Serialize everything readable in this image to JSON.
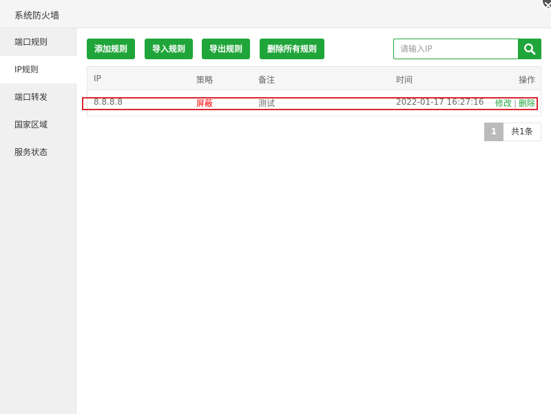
{
  "window": {
    "title": "系统防火墙"
  },
  "sidebar": {
    "items": [
      {
        "label": "端口规则"
      },
      {
        "label": "IP规则"
      },
      {
        "label": "端口转发"
      },
      {
        "label": "国家区域"
      },
      {
        "label": "服务状态"
      }
    ],
    "active_index": 1
  },
  "toolbar": {
    "add_label": "添加规则",
    "import_label": "导入规则",
    "export_label": "导出规则",
    "delete_all_label": "删除所有规则"
  },
  "search": {
    "placeholder": "请输入IP",
    "value": ""
  },
  "table": {
    "columns": [
      "IP",
      "策略",
      "备注",
      "时间",
      "操作"
    ],
    "rows": [
      {
        "ip": "8.8.8.8",
        "strategy": "屏蔽",
        "note": "测试",
        "time": "2022-01-17 16:27:16",
        "edit": "修改",
        "separator": "|",
        "delete": "删除"
      }
    ]
  },
  "pagination": {
    "current_page": "1",
    "total_text": "共1条"
  },
  "colors": {
    "accent": "#20a53a",
    "danger": "#ff0000",
    "highlight_border": "#d9232d",
    "sidebar_bg": "#f0f0f0"
  },
  "icons": {
    "close": "close-icon",
    "search": "search-icon"
  }
}
